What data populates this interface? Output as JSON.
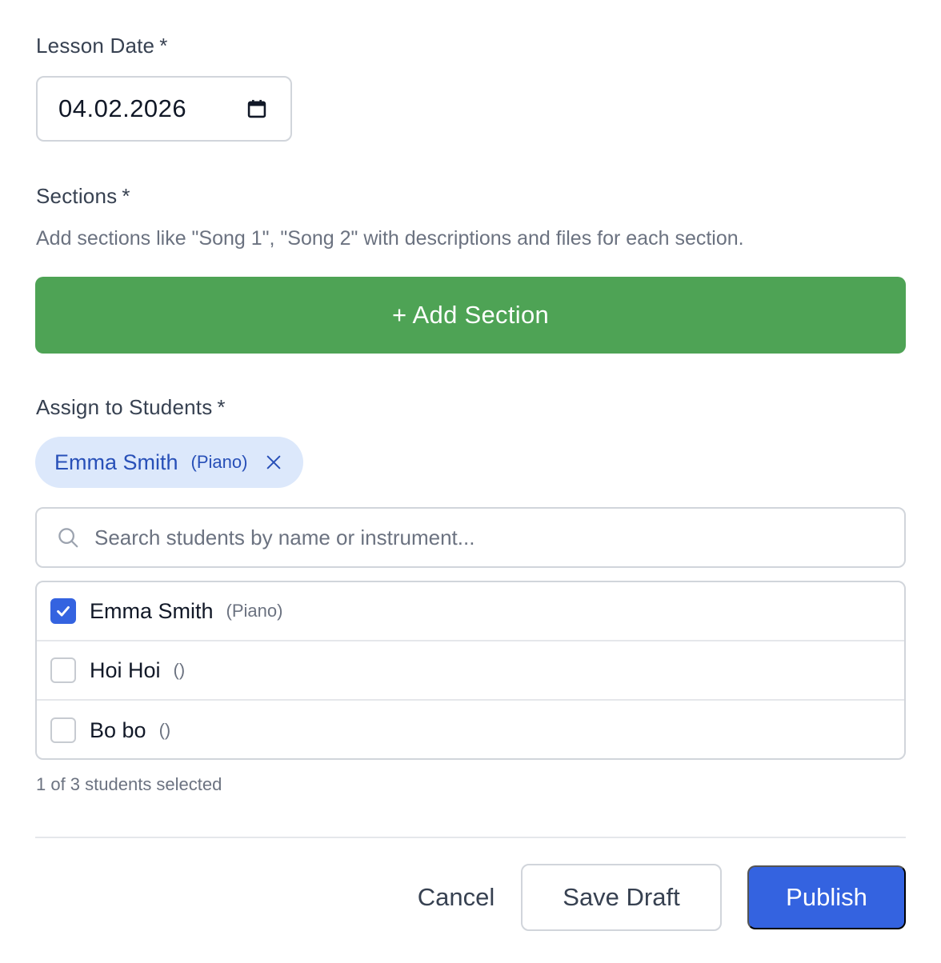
{
  "lesson_date": {
    "label": "Lesson Date",
    "required_marker": "*",
    "value": "04.02.2026",
    "icon": "calendar-icon"
  },
  "sections": {
    "label": "Sections",
    "required_marker": "*",
    "help_text": "Add sections like \"Song 1\", \"Song 2\" with descriptions and files for each section.",
    "add_button_label": "+ Add Section",
    "add_button_color": "#4ea355"
  },
  "students": {
    "label": "Assign to Students",
    "required_marker": "*",
    "selected_chips": [
      {
        "name": "Emma Smith",
        "instrument": "(Piano)",
        "icon": "close-icon"
      }
    ],
    "search_placeholder": "Search students by name or instrument...",
    "search_value": "",
    "list": [
      {
        "name": "Emma Smith",
        "instrument": "(Piano)",
        "checked": true
      },
      {
        "name": "Hoi Hoi",
        "instrument": "()",
        "checked": false
      },
      {
        "name": "Bo bo",
        "instrument": "()",
        "checked": false
      }
    ],
    "selection_count": "1 of 3 students selected"
  },
  "actions": {
    "cancel_label": "Cancel",
    "save_draft_label": "Save Draft",
    "publish_label": "Publish",
    "accent_color": "#3463e0"
  }
}
